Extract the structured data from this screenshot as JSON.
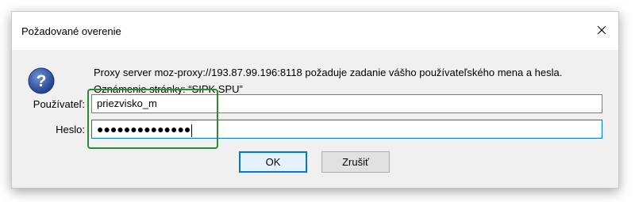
{
  "dialog": {
    "title": "Požadované overenie",
    "message_line1": "Proxy server moz-proxy://193.87.99.196:8118 požaduje zadanie vášho používateľského mena a hesla.",
    "message_line2": "Oznámenie stránky: “SIPK SPU”",
    "icon": "question-icon",
    "close_icon": "close-icon"
  },
  "form": {
    "username_label": "Používateľ:",
    "username_value": "priezvisko_m",
    "password_label": "Heslo:",
    "password_masked": "●●●●●●●●●●●●●●"
  },
  "buttons": {
    "ok_label": "OK",
    "cancel_label": "Zrušiť"
  },
  "colors": {
    "accent": "#0078d7",
    "highlight": "#2f8a2f",
    "dialog_body": "#f0f0f0"
  }
}
